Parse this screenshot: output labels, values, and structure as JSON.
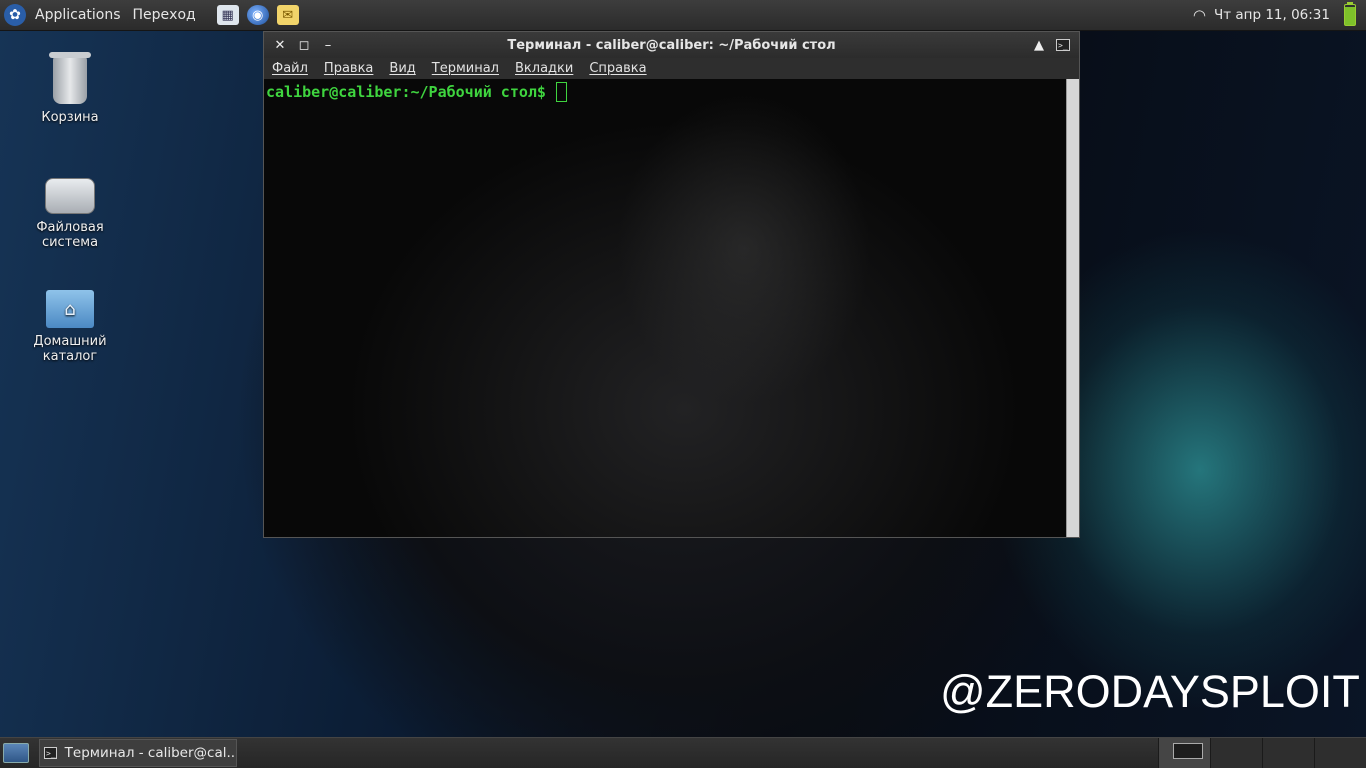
{
  "top_panel": {
    "applications": "Applications",
    "goto": "Переход",
    "clock": "Чт апр 11, 06:31"
  },
  "desktop": {
    "icons": [
      {
        "label": "Корзина",
        "icon": "trash-icon"
      },
      {
        "label": "Файловая система",
        "icon": "drive-icon"
      },
      {
        "label": "Домашний каталог",
        "icon": "home-folder-icon"
      }
    ]
  },
  "terminal": {
    "title": "Терминал - caliber@caliber: ~/Рабочий стол",
    "menu": [
      "Файл",
      "Правка",
      "Вид",
      "Терминал",
      "Вкладки",
      "Справка"
    ],
    "prompt": "caliber@caliber:~/Рабочий стол$",
    "prompt_color": "#3fd43f"
  },
  "watermark": "@ZERODAYSPLOIT",
  "taskbar": {
    "task_label": "Терминал - caliber@cal..."
  }
}
